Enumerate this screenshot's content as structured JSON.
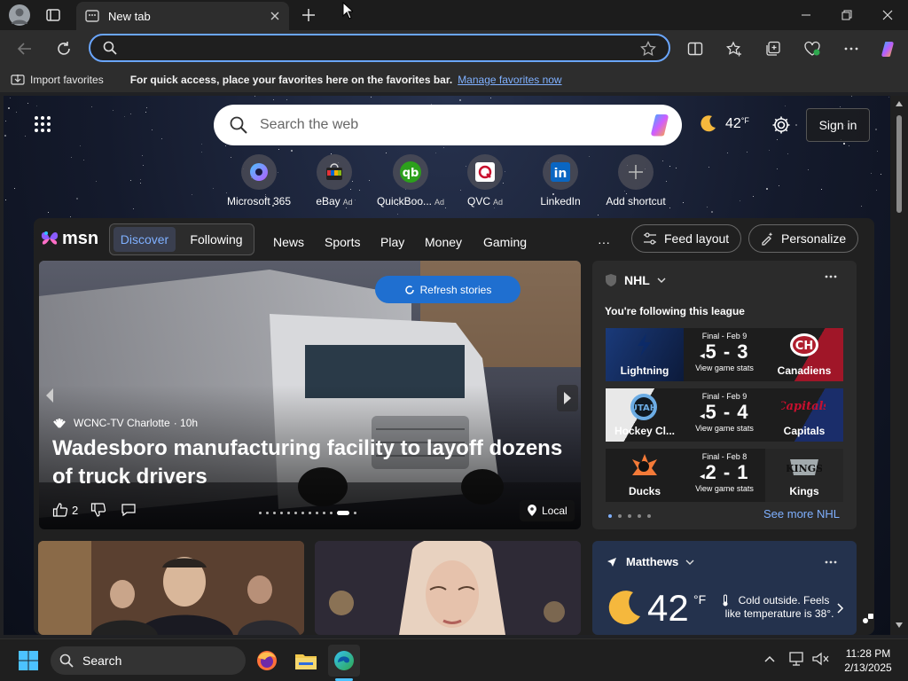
{
  "browser": {
    "tab_title": "New tab",
    "address_placeholder": "",
    "favorites_bar": {
      "import_label": "Import favorites",
      "tip": "For quick access, place your favorites here on the favorites bar.",
      "manage_link": "Manage favorites now"
    }
  },
  "newtab": {
    "search_placeholder": "Search the web",
    "weather_temp": "42",
    "weather_unit": "°F",
    "sign_in": "Sign in",
    "shortcuts": [
      {
        "label": "Microsoft 365",
        "ad": ""
      },
      {
        "label": "eBay",
        "ad": "Ad"
      },
      {
        "label": "QuickBoo...",
        "ad": "Ad"
      },
      {
        "label": "QVC",
        "ad": "Ad"
      },
      {
        "label": "LinkedIn",
        "ad": ""
      },
      {
        "label": "Add shortcut",
        "ad": ""
      }
    ]
  },
  "feed": {
    "brand": "msn",
    "tabs": {
      "discover": "Discover",
      "following": "Following"
    },
    "nav": [
      "News",
      "Sports",
      "Play",
      "Money",
      "Gaming"
    ],
    "more": "···",
    "feed_layout": "Feed layout",
    "personalize": "Personalize",
    "refresh": "Refresh stories",
    "hero": {
      "source": "WCNC-TV Charlotte",
      "age": "· 10h",
      "headline": "Wadesboro manufacturing facility to layoff dozens of truck drivers",
      "likes": "2",
      "local": "Local"
    },
    "nhl": {
      "title": "NHL",
      "subtitle": "You're following this league",
      "games": [
        {
          "status": "Final - Feb 9",
          "score": "5 - 3",
          "home": "Lightning",
          "away": "Canadiens",
          "stats": "View game stats",
          "lcolor": "#1a3a7a",
          "rcolor": "#a01628"
        },
        {
          "status": "Final - Feb 9",
          "score": "5 - 4",
          "home": "Hockey Cl...",
          "away": "Capitals",
          "stats": "View game stats",
          "lcolor": "#e8e8e8",
          "rcolor": "#1a2d6a"
        },
        {
          "status": "Final - Feb 8",
          "score": "2 - 1",
          "home": "Ducks",
          "away": "Kings",
          "stats": "View game stats",
          "lcolor": "#2a2a2a",
          "rcolor": "#3a3a3a"
        }
      ],
      "see_more": "See more NHL"
    },
    "weather": {
      "location": "Matthews",
      "temp": "42",
      "unit": "°F",
      "note": "Cold outside. Feels like temperature is 38°."
    }
  },
  "taskbar": {
    "search": "Search",
    "time": "11:28 PM",
    "date": "2/13/2025"
  },
  "colors": {
    "accent": "#1f6fd0",
    "link": "#7fb0ff",
    "focus": "#6aa6ff"
  }
}
